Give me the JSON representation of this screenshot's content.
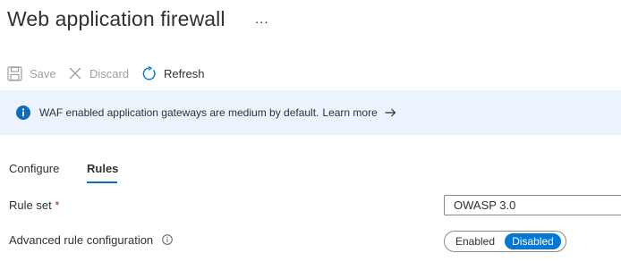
{
  "header": {
    "title": "Web application firewall",
    "more_label": "..."
  },
  "toolbar": {
    "save_label": "Save",
    "discard_label": "Discard",
    "refresh_label": "Refresh"
  },
  "infobar": {
    "text": "WAF enabled application gateways are medium by default.",
    "link_label": "Learn more",
    "icon": "info-icon",
    "accent": "#0f6cbd",
    "background": "#ebf3fc"
  },
  "tabs": [
    {
      "label": "Configure",
      "active": false
    },
    {
      "label": "Rules",
      "active": true
    }
  ],
  "form": {
    "rule_set": {
      "label": "Rule set",
      "required_mark": "*",
      "value": "OWASP 3.0"
    },
    "advanced": {
      "label": "Advanced rule configuration",
      "options": [
        "Enabled",
        "Disabled"
      ],
      "selected": "Disabled"
    }
  },
  "colors": {
    "primary": "#0078d4",
    "text": "#323130",
    "disabled": "#a19f9d"
  }
}
